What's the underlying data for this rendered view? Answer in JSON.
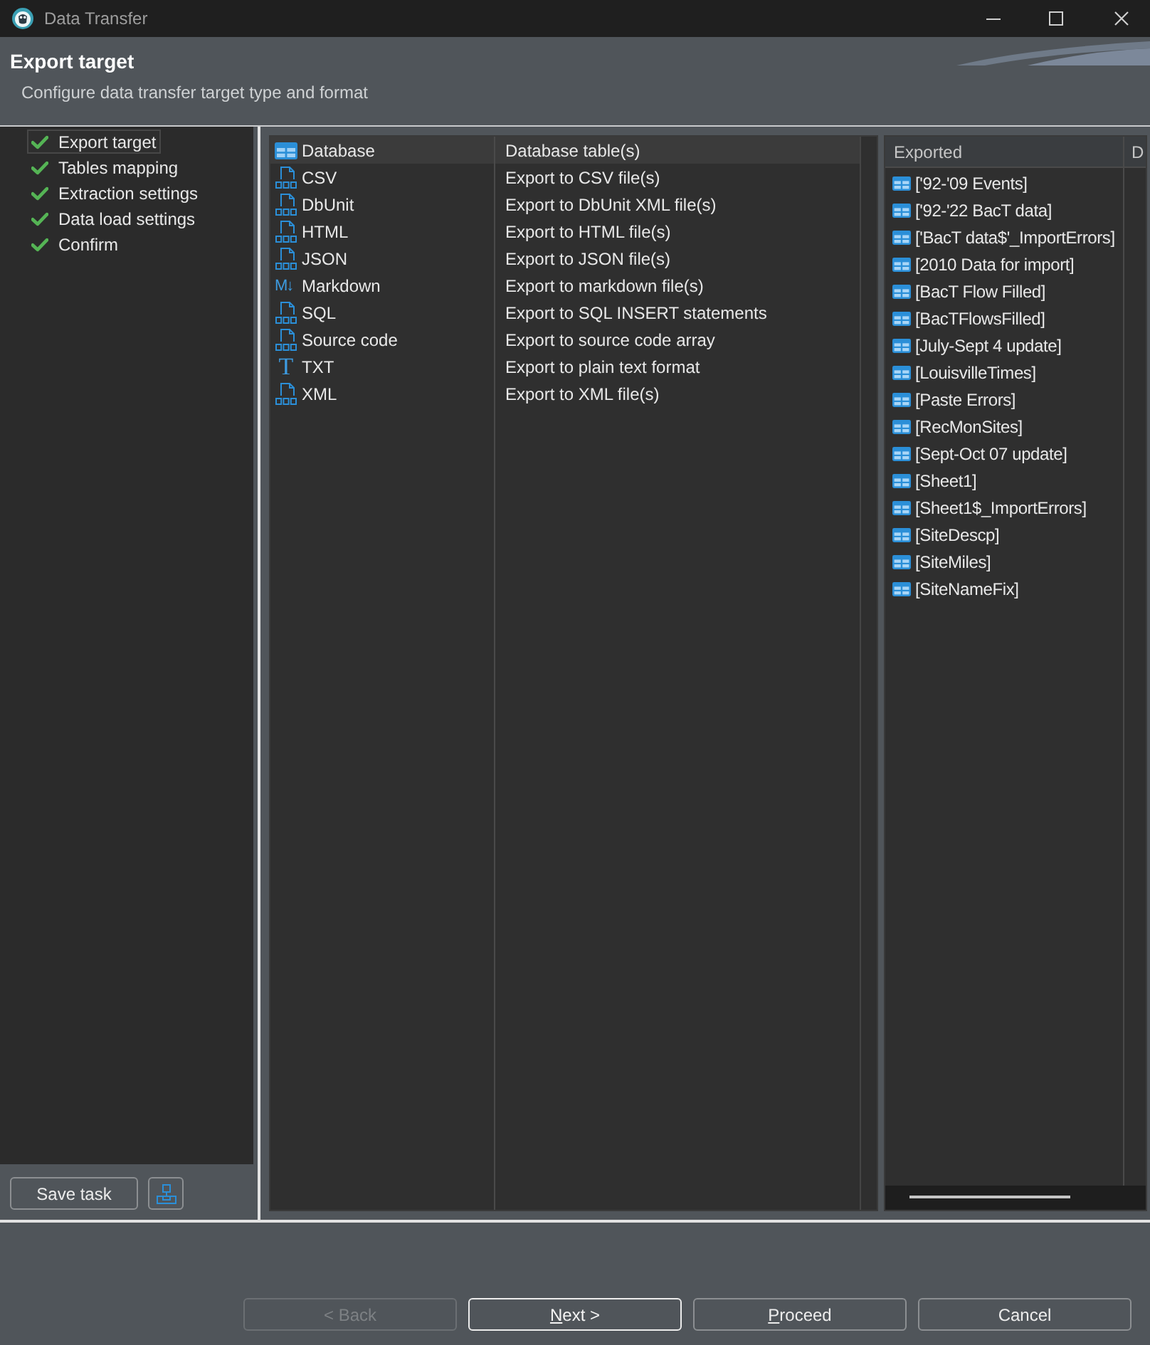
{
  "window": {
    "title": "Data Transfer"
  },
  "header": {
    "title": "Export target",
    "subtitle": "Configure data transfer target type and format"
  },
  "steps": [
    {
      "label": "Export target",
      "completed": true,
      "selected": true
    },
    {
      "label": "Tables mapping",
      "completed": true,
      "selected": false
    },
    {
      "label": "Extraction settings",
      "completed": true,
      "selected": false
    },
    {
      "label": "Data load settings",
      "completed": true,
      "selected": false
    },
    {
      "label": "Confirm",
      "completed": true,
      "selected": false
    }
  ],
  "step_actions": {
    "save_task": "Save task"
  },
  "formats": [
    {
      "kind": "table",
      "name": "Database",
      "description": "Database table(s)",
      "selected": true
    },
    {
      "kind": "file",
      "name": "CSV",
      "description": "Export to CSV file(s)",
      "selected": false
    },
    {
      "kind": "file",
      "name": "DbUnit",
      "description": "Export to DbUnit XML file(s)",
      "selected": false
    },
    {
      "kind": "file",
      "name": "HTML",
      "description": "Export to HTML file(s)",
      "selected": false
    },
    {
      "kind": "file",
      "name": "JSON",
      "description": "Export to JSON file(s)",
      "selected": false
    },
    {
      "kind": "markdown",
      "glyph": "M↓",
      "name": "Markdown",
      "description": "Export to markdown file(s)",
      "selected": false
    },
    {
      "kind": "file",
      "name": "SQL",
      "description": "Export to SQL INSERT statements",
      "selected": false
    },
    {
      "kind": "file",
      "name": "Source code",
      "description": "Export to source code array",
      "selected": false
    },
    {
      "kind": "letter",
      "glyph": "T",
      "name": "TXT",
      "description": "Export to plain text format",
      "selected": false
    },
    {
      "kind": "file",
      "name": "XML",
      "description": "Export to XML file(s)",
      "selected": false
    }
  ],
  "exported": {
    "columns": [
      "Exported",
      "D"
    ],
    "tables": [
      "['92-'09 Events]",
      "['92-'22 BacT data]",
      "['BacT data$'_ImportErrors]",
      "[2010 Data for import]",
      "[BacT Flow Filled]",
      "[BacTFlowsFilled]",
      "[July-Sept 4 update]",
      "[LouisvilleTimes]",
      "[Paste Errors]",
      "[RecMonSites]",
      "[Sept-Oct 07 update]",
      "[Sheet1]",
      "[Sheet1$_ImportErrors]",
      "[SiteDescp]",
      "[SiteMiles]",
      "[SiteNameFix]"
    ]
  },
  "buttons": [
    {
      "label": "< Back",
      "disabled": true,
      "focused": false,
      "underline_first": false
    },
    {
      "label": "Next >",
      "disabled": false,
      "focused": true,
      "underline_first": true
    },
    {
      "label": "Proceed",
      "disabled": false,
      "focused": false,
      "underline_first": true
    },
    {
      "label": "Cancel",
      "disabled": false,
      "focused": false,
      "underline_first": false
    }
  ]
}
